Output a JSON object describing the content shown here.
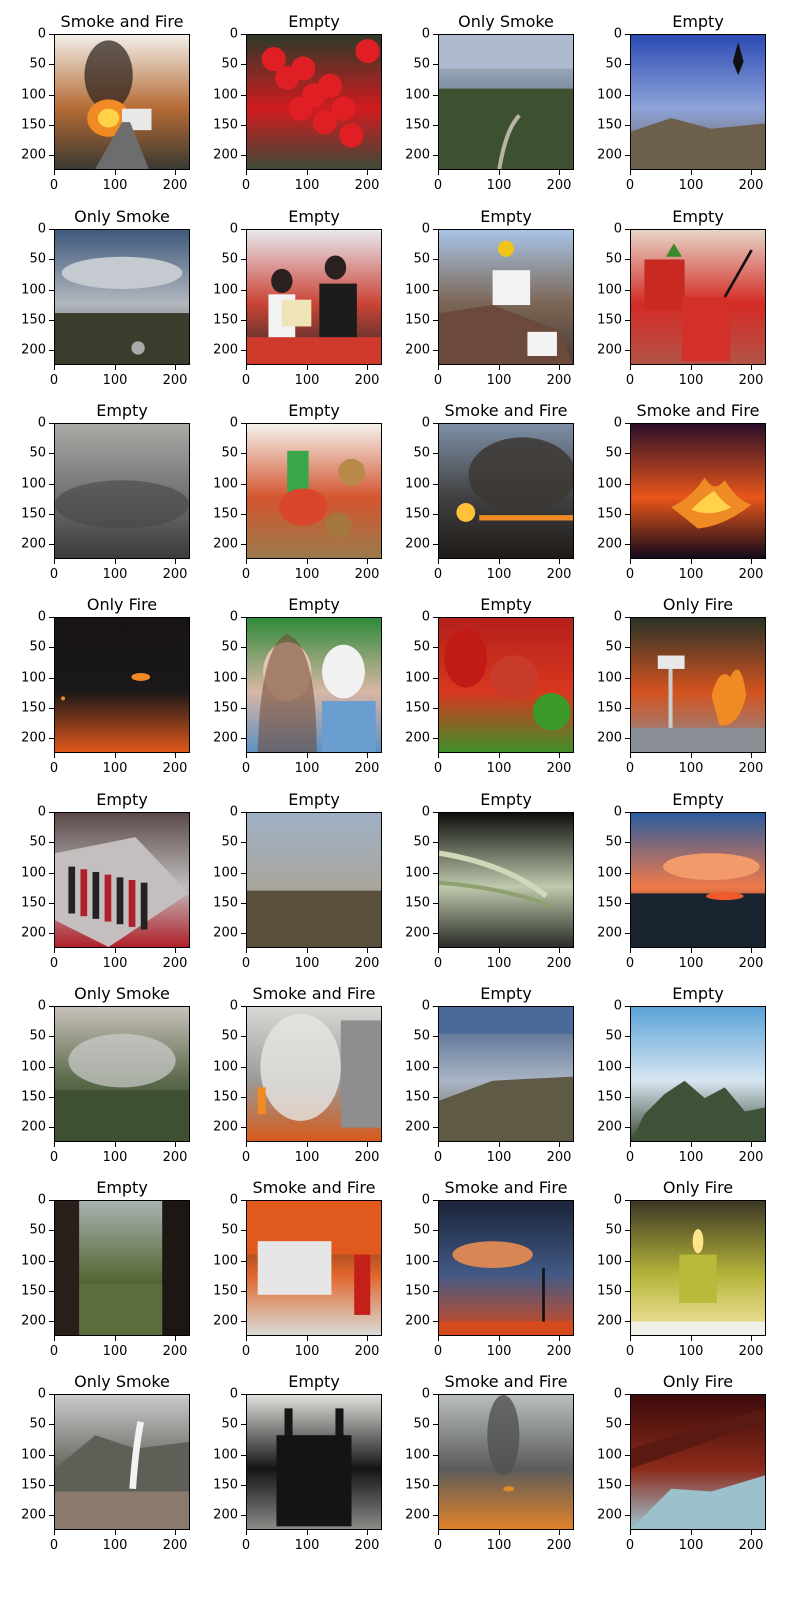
{
  "figure": {
    "background": "#ffffff",
    "rows": 8,
    "cols": 4
  },
  "axis_ticks": {
    "x": [
      "0",
      "100",
      "200"
    ],
    "y": [
      "0",
      "50",
      "100",
      "150",
      "200"
    ]
  },
  "chart_data": {
    "type": "image_grid",
    "xlim": [
      0,
      224
    ],
    "ylim": [
      224,
      0
    ],
    "xticks": [
      0,
      100,
      200
    ],
    "yticks": [
      0,
      50,
      100,
      150,
      200
    ],
    "panels": [
      {
        "title": "Smoke and Fire",
        "scene": "burning-truck",
        "colors": [
          "#f2efe8",
          "#b46a34",
          "#3b3a33"
        ]
      },
      {
        "title": "Empty",
        "scene": "red-balloons",
        "colors": [
          "#2f3a2a",
          "#d01b1f",
          "#3d4a38"
        ]
      },
      {
        "title": "Only Smoke",
        "scene": "city-view-fisheye",
        "colors": [
          "#bcc6d6",
          "#6b7d8d",
          "#3b4a32"
        ]
      },
      {
        "title": "Empty",
        "scene": "mountain-sky",
        "colors": [
          "#2b4bb4",
          "#8fa3d9",
          "#6a5e4c"
        ]
      },
      {
        "title": "Only Smoke",
        "scene": "cloudy-hills",
        "colors": [
          "#3f5a7c",
          "#b2b8bf",
          "#3d3e30"
        ]
      },
      {
        "title": "Empty",
        "scene": "ceremony-people",
        "colors": [
          "#e8e8ef",
          "#cb4335",
          "#2c2c2c"
        ]
      },
      {
        "title": "Empty",
        "scene": "worker-sign",
        "colors": [
          "#a8c4e6",
          "#7b6655",
          "#4a3d35"
        ]
      },
      {
        "title": "Empty",
        "scene": "watermelon-drinks",
        "colors": [
          "#e6d5c8",
          "#d42b25",
          "#b35347"
        ]
      },
      {
        "title": "Empty",
        "scene": "grey-fog",
        "colors": [
          "#a9a9a6",
          "#707070",
          "#3b3b39"
        ]
      },
      {
        "title": "Empty",
        "scene": "blurred-cartoon",
        "colors": [
          "#f4f1ec",
          "#d3552f",
          "#9a7a4a"
        ]
      },
      {
        "title": "Smoke and Fire",
        "scene": "sunset-smoke-fire",
        "colors": [
          "#7d8fa6",
          "#414141",
          "#1e1a17"
        ]
      },
      {
        "title": "Smoke and Fire",
        "scene": "night-fire",
        "colors": [
          "#2c0f2a",
          "#e8561a",
          "#130a1c"
        ]
      },
      {
        "title": "Only Fire",
        "scene": "dark-distant-fire",
        "colors": [
          "#171413",
          "#1a1818",
          "#e0581c"
        ]
      },
      {
        "title": "Empty",
        "scene": "two-people",
        "colors": [
          "#2f8a3a",
          "#d8b7a4",
          "#5c90c4"
        ]
      },
      {
        "title": "Empty",
        "scene": "red-peppers",
        "colors": [
          "#b5201b",
          "#d8371f",
          "#3e8f2a"
        ]
      },
      {
        "title": "Only Fire",
        "scene": "forest-fire-sign",
        "colors": [
          "#2a3327",
          "#d4521f",
          "#8a8f96"
        ]
      },
      {
        "title": "Empty",
        "scene": "cosmetics",
        "colors": [
          "#5c4a4a",
          "#c0bcbc",
          "#b0202a"
        ]
      },
      {
        "title": "Empty",
        "scene": "plain-landscape",
        "colors": [
          "#9fb0c6",
          "#a9a69d",
          "#4c4336"
        ]
      },
      {
        "title": "Empty",
        "scene": "night-bridge-lights",
        "colors": [
          "#0d0f0c",
          "#bfc9ad",
          "#2a2d27"
        ]
      },
      {
        "title": "Empty",
        "scene": "sunset-lake",
        "colors": [
          "#2b5c9f",
          "#f07a4a",
          "#101820"
        ]
      },
      {
        "title": "Only Smoke",
        "scene": "smoky-forest",
        "colors": [
          "#c7c1ba",
          "#5b6a4a",
          "#31402a"
        ]
      },
      {
        "title": "Smoke and Fire",
        "scene": "burning-building",
        "colors": [
          "#d9d8d4",
          "#9a9a96",
          "#d65a1b"
        ]
      },
      {
        "title": "Empty",
        "scene": "aerial-city",
        "colors": [
          "#3e5a86",
          "#a9b4c4",
          "#6a6352"
        ]
      },
      {
        "title": "Empty",
        "scene": "mountain-peaks",
        "colors": [
          "#5aa3d8",
          "#d7e6f1",
          "#3d4a39"
        ]
      },
      {
        "title": "Empty",
        "scene": "fisheye-green",
        "colors": [
          "#a9b1b3",
          "#5b6d3a",
          "#2a1f1a"
        ]
      },
      {
        "title": "Smoke and Fire",
        "scene": "firefighters",
        "colors": [
          "#3a1e13",
          "#e0652a",
          "#d8dcd8"
        ]
      },
      {
        "title": "Smoke and Fire",
        "scene": "night-tower-fire",
        "colors": [
          "#1a2338",
          "#425a86",
          "#d64a1e"
        ]
      },
      {
        "title": "Only Fire",
        "scene": "candle",
        "colors": [
          "#3d3725",
          "#b4b43a",
          "#f5e7a6"
        ]
      },
      {
        "title": "Only Smoke",
        "scene": "town-smoke",
        "colors": [
          "#c9cbcc",
          "#65665d",
          "#8c7f72"
        ]
      },
      {
        "title": "Empty",
        "scene": "black-bag",
        "colors": [
          "#e0e1dc",
          "#141414",
          "#8a8c88"
        ]
      },
      {
        "title": "Smoke and Fire",
        "scene": "smoke-column",
        "colors": [
          "#b9bebe",
          "#5b5c5b",
          "#e0822a"
        ]
      },
      {
        "title": "Only Fire",
        "scene": "blurry-fire",
        "colors": [
          "#3d0c0c",
          "#8b2a1a",
          "#9ec4d0"
        ]
      }
    ]
  }
}
